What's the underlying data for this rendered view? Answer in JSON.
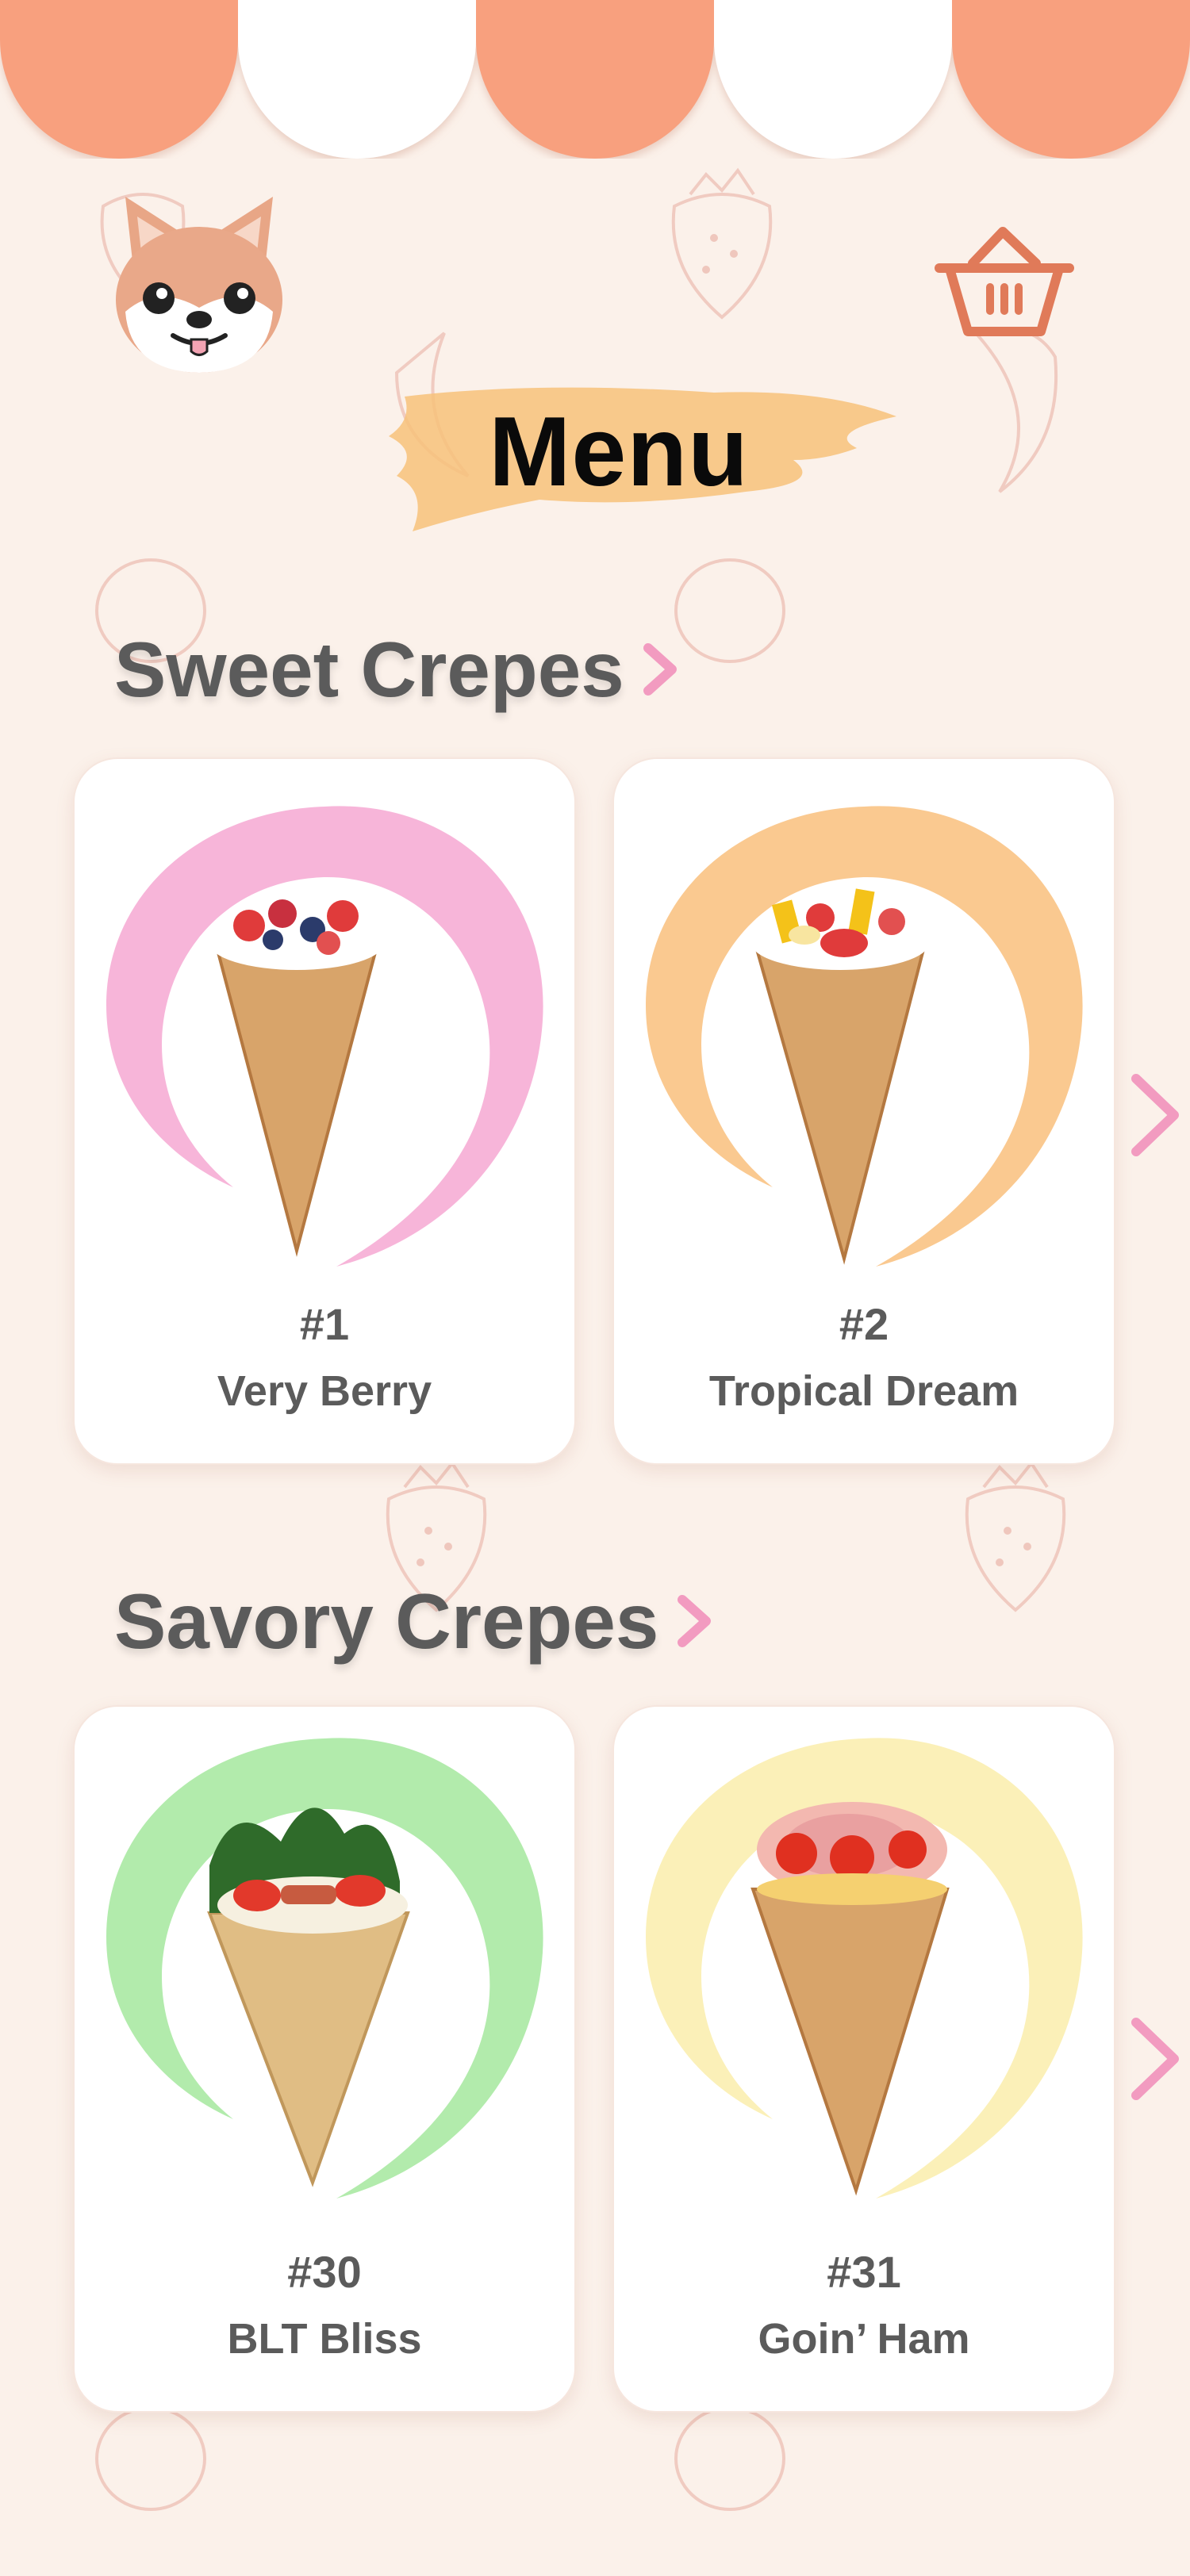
{
  "header": {
    "title": "Menu",
    "avatar_icon": "shiba-dog-icon",
    "cart_icon": "basket-icon"
  },
  "colors": {
    "background": "#fbf1ea",
    "awning_orange": "#f8a07e",
    "accent_pink": "#f29bc0",
    "title_brush": "#f7c27a",
    "text_gray": "#5b5b5b"
  },
  "sections": [
    {
      "title": "Sweet Crepes",
      "items": [
        {
          "number": "#1",
          "name": "Very Berry",
          "splash_color": "#f6a8d2"
        },
        {
          "number": "#2",
          "name": "Tropical Dream",
          "splash_color": "#f9bf7c"
        }
      ]
    },
    {
      "title": "Savory Crepes",
      "items": [
        {
          "number": "#30",
          "name": "BLT Bliss",
          "splash_color": "#a4e79e"
        },
        {
          "number": "#31",
          "name": "Goin’ Ham",
          "splash_color": "#fbeeb0"
        }
      ]
    }
  ]
}
